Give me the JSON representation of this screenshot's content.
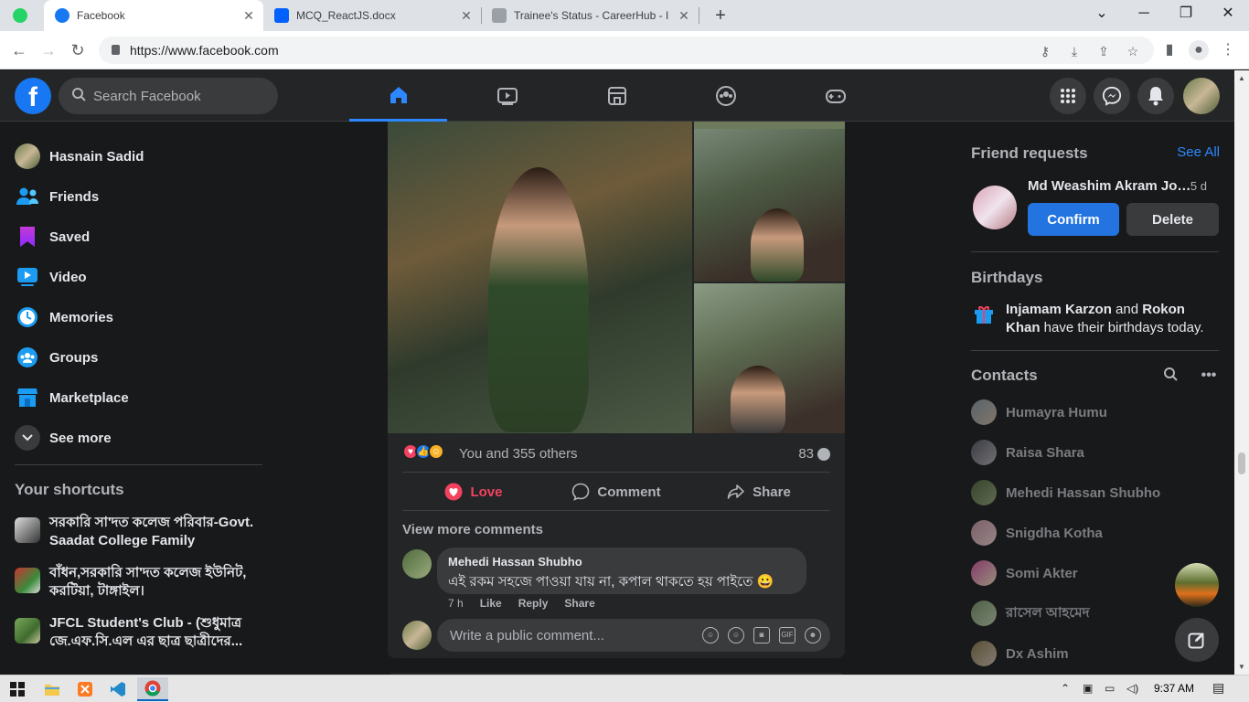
{
  "browser": {
    "tabs": [
      {
        "title": "Facebook",
        "active": true
      },
      {
        "title": "MCQ_ReactJS.docx",
        "active": false
      },
      {
        "title": "Trainee's Status - CareerHub - Isl",
        "active": false
      }
    ],
    "new_tab": "+",
    "url": "https://www.facebook.com"
  },
  "header": {
    "logo": "f",
    "search_placeholder": "Search Facebook",
    "nav_icons": [
      "home-icon",
      "video-icon",
      "marketplace-icon",
      "groups-icon",
      "gaming-icon"
    ],
    "action_icons": [
      "menu-icon",
      "messenger-icon",
      "notifications-icon"
    ]
  },
  "left_sidebar": {
    "items": [
      {
        "label": "Hasnain Sadid",
        "icon": "profile-avatar"
      },
      {
        "label": "Friends",
        "icon": "friends-icon"
      },
      {
        "label": "Saved",
        "icon": "saved-icon"
      },
      {
        "label": "Video",
        "icon": "video-icon"
      },
      {
        "label": "Memories",
        "icon": "memories-icon"
      },
      {
        "label": "Groups",
        "icon": "groups-icon"
      },
      {
        "label": "Marketplace",
        "icon": "marketplace-icon"
      },
      {
        "label": "See more",
        "icon": "chevron-down-icon"
      }
    ],
    "shortcuts_title": "Your shortcuts",
    "shortcuts": [
      {
        "label": "সরকারি সা'দত কলেজ পরিবার-Govt. Saadat College Family"
      },
      {
        "label": "বাঁধন,সরকারি সা'দত কলেজ ইউনিট, করটিয়া, টাঙ্গাইল।"
      },
      {
        "label": "JFCL Student's Club - (শুধুমাত্র জে.এফ.সি.এল এর ছাত্র ছাত্রীদের..."
      }
    ]
  },
  "post": {
    "reactions_text": "You and 355 others",
    "comments_count": "83",
    "actions": {
      "love": "Love",
      "comment": "Comment",
      "share": "Share"
    },
    "view_more_comments": "View more comments",
    "comment": {
      "author": "Mehedi Hassan Shubho",
      "text": "এই রকম সহজে পাওয়া যায় না, কপাল থাকতে হয় পাইতে 😀",
      "time": "7 h",
      "like": "Like",
      "reply": "Reply",
      "share": "Share"
    },
    "write_placeholder": "Write a public comment..."
  },
  "right_sidebar": {
    "friend_requests_title": "Friend requests",
    "see_all": "See All",
    "request": {
      "name": "Md Weashim Akram Jon...",
      "time": "5 d",
      "confirm": "Confirm",
      "delete": "Delete"
    },
    "birthdays_title": "Birthdays",
    "birthday_names": [
      "Injamam Karzon",
      "Rokon Khan"
    ],
    "birthday_and": "and",
    "birthday_suffix": "have their birthdays today.",
    "contacts_title": "Contacts",
    "contacts": [
      "Humayra Humu",
      "Raisa Shara",
      "Mehedi Hassan Shubho",
      "Snigdha Kotha",
      "Somi Akter",
      "রাসেল আহমেদ",
      "Dx Ashim"
    ]
  },
  "taskbar": {
    "time": "9:37 AM"
  },
  "colors": {
    "fb_blue": "#2374e1",
    "love_red": "#f3425f",
    "link_blue": "#2d88ff",
    "background": "#18191a",
    "surface": "#242526"
  }
}
